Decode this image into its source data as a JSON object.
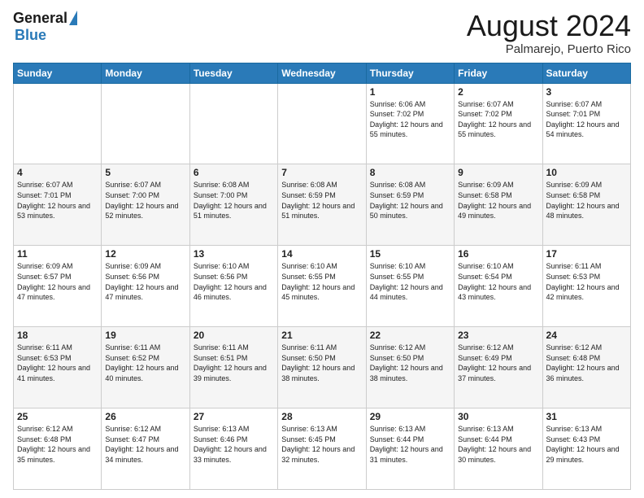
{
  "header": {
    "logo_general": "General",
    "logo_blue": "Blue",
    "month_year": "August 2024",
    "location": "Palmarejo, Puerto Rico"
  },
  "weekdays": [
    "Sunday",
    "Monday",
    "Tuesday",
    "Wednesday",
    "Thursday",
    "Friday",
    "Saturday"
  ],
  "weeks": [
    [
      {
        "day": "",
        "sunrise": "",
        "sunset": "",
        "daylight": ""
      },
      {
        "day": "",
        "sunrise": "",
        "sunset": "",
        "daylight": ""
      },
      {
        "day": "",
        "sunrise": "",
        "sunset": "",
        "daylight": ""
      },
      {
        "day": "",
        "sunrise": "",
        "sunset": "",
        "daylight": ""
      },
      {
        "day": "1",
        "sunrise": "Sunrise: 6:06 AM",
        "sunset": "Sunset: 7:02 PM",
        "daylight": "Daylight: 12 hours and 55 minutes."
      },
      {
        "day": "2",
        "sunrise": "Sunrise: 6:07 AM",
        "sunset": "Sunset: 7:02 PM",
        "daylight": "Daylight: 12 hours and 55 minutes."
      },
      {
        "day": "3",
        "sunrise": "Sunrise: 6:07 AM",
        "sunset": "Sunset: 7:01 PM",
        "daylight": "Daylight: 12 hours and 54 minutes."
      }
    ],
    [
      {
        "day": "4",
        "sunrise": "Sunrise: 6:07 AM",
        "sunset": "Sunset: 7:01 PM",
        "daylight": "Daylight: 12 hours and 53 minutes."
      },
      {
        "day": "5",
        "sunrise": "Sunrise: 6:07 AM",
        "sunset": "Sunset: 7:00 PM",
        "daylight": "Daylight: 12 hours and 52 minutes."
      },
      {
        "day": "6",
        "sunrise": "Sunrise: 6:08 AM",
        "sunset": "Sunset: 7:00 PM",
        "daylight": "Daylight: 12 hours and 51 minutes."
      },
      {
        "day": "7",
        "sunrise": "Sunrise: 6:08 AM",
        "sunset": "Sunset: 6:59 PM",
        "daylight": "Daylight: 12 hours and 51 minutes."
      },
      {
        "day": "8",
        "sunrise": "Sunrise: 6:08 AM",
        "sunset": "Sunset: 6:59 PM",
        "daylight": "Daylight: 12 hours and 50 minutes."
      },
      {
        "day": "9",
        "sunrise": "Sunrise: 6:09 AM",
        "sunset": "Sunset: 6:58 PM",
        "daylight": "Daylight: 12 hours and 49 minutes."
      },
      {
        "day": "10",
        "sunrise": "Sunrise: 6:09 AM",
        "sunset": "Sunset: 6:58 PM",
        "daylight": "Daylight: 12 hours and 48 minutes."
      }
    ],
    [
      {
        "day": "11",
        "sunrise": "Sunrise: 6:09 AM",
        "sunset": "Sunset: 6:57 PM",
        "daylight": "Daylight: 12 hours and 47 minutes."
      },
      {
        "day": "12",
        "sunrise": "Sunrise: 6:09 AM",
        "sunset": "Sunset: 6:56 PM",
        "daylight": "Daylight: 12 hours and 47 minutes."
      },
      {
        "day": "13",
        "sunrise": "Sunrise: 6:10 AM",
        "sunset": "Sunset: 6:56 PM",
        "daylight": "Daylight: 12 hours and 46 minutes."
      },
      {
        "day": "14",
        "sunrise": "Sunrise: 6:10 AM",
        "sunset": "Sunset: 6:55 PM",
        "daylight": "Daylight: 12 hours and 45 minutes."
      },
      {
        "day": "15",
        "sunrise": "Sunrise: 6:10 AM",
        "sunset": "Sunset: 6:55 PM",
        "daylight": "Daylight: 12 hours and 44 minutes."
      },
      {
        "day": "16",
        "sunrise": "Sunrise: 6:10 AM",
        "sunset": "Sunset: 6:54 PM",
        "daylight": "Daylight: 12 hours and 43 minutes."
      },
      {
        "day": "17",
        "sunrise": "Sunrise: 6:11 AM",
        "sunset": "Sunset: 6:53 PM",
        "daylight": "Daylight: 12 hours and 42 minutes."
      }
    ],
    [
      {
        "day": "18",
        "sunrise": "Sunrise: 6:11 AM",
        "sunset": "Sunset: 6:53 PM",
        "daylight": "Daylight: 12 hours and 41 minutes."
      },
      {
        "day": "19",
        "sunrise": "Sunrise: 6:11 AM",
        "sunset": "Sunset: 6:52 PM",
        "daylight": "Daylight: 12 hours and 40 minutes."
      },
      {
        "day": "20",
        "sunrise": "Sunrise: 6:11 AM",
        "sunset": "Sunset: 6:51 PM",
        "daylight": "Daylight: 12 hours and 39 minutes."
      },
      {
        "day": "21",
        "sunrise": "Sunrise: 6:11 AM",
        "sunset": "Sunset: 6:50 PM",
        "daylight": "Daylight: 12 hours and 38 minutes."
      },
      {
        "day": "22",
        "sunrise": "Sunrise: 6:12 AM",
        "sunset": "Sunset: 6:50 PM",
        "daylight": "Daylight: 12 hours and 38 minutes."
      },
      {
        "day": "23",
        "sunrise": "Sunrise: 6:12 AM",
        "sunset": "Sunset: 6:49 PM",
        "daylight": "Daylight: 12 hours and 37 minutes."
      },
      {
        "day": "24",
        "sunrise": "Sunrise: 6:12 AM",
        "sunset": "Sunset: 6:48 PM",
        "daylight": "Daylight: 12 hours and 36 minutes."
      }
    ],
    [
      {
        "day": "25",
        "sunrise": "Sunrise: 6:12 AM",
        "sunset": "Sunset: 6:48 PM",
        "daylight": "Daylight: 12 hours and 35 minutes."
      },
      {
        "day": "26",
        "sunrise": "Sunrise: 6:12 AM",
        "sunset": "Sunset: 6:47 PM",
        "daylight": "Daylight: 12 hours and 34 minutes."
      },
      {
        "day": "27",
        "sunrise": "Sunrise: 6:13 AM",
        "sunset": "Sunset: 6:46 PM",
        "daylight": "Daylight: 12 hours and 33 minutes."
      },
      {
        "day": "28",
        "sunrise": "Sunrise: 6:13 AM",
        "sunset": "Sunset: 6:45 PM",
        "daylight": "Daylight: 12 hours and 32 minutes."
      },
      {
        "day": "29",
        "sunrise": "Sunrise: 6:13 AM",
        "sunset": "Sunset: 6:44 PM",
        "daylight": "Daylight: 12 hours and 31 minutes."
      },
      {
        "day": "30",
        "sunrise": "Sunrise: 6:13 AM",
        "sunset": "Sunset: 6:44 PM",
        "daylight": "Daylight: 12 hours and 30 minutes."
      },
      {
        "day": "31",
        "sunrise": "Sunrise: 6:13 AM",
        "sunset": "Sunset: 6:43 PM",
        "daylight": "Daylight: 12 hours and 29 minutes."
      }
    ]
  ]
}
